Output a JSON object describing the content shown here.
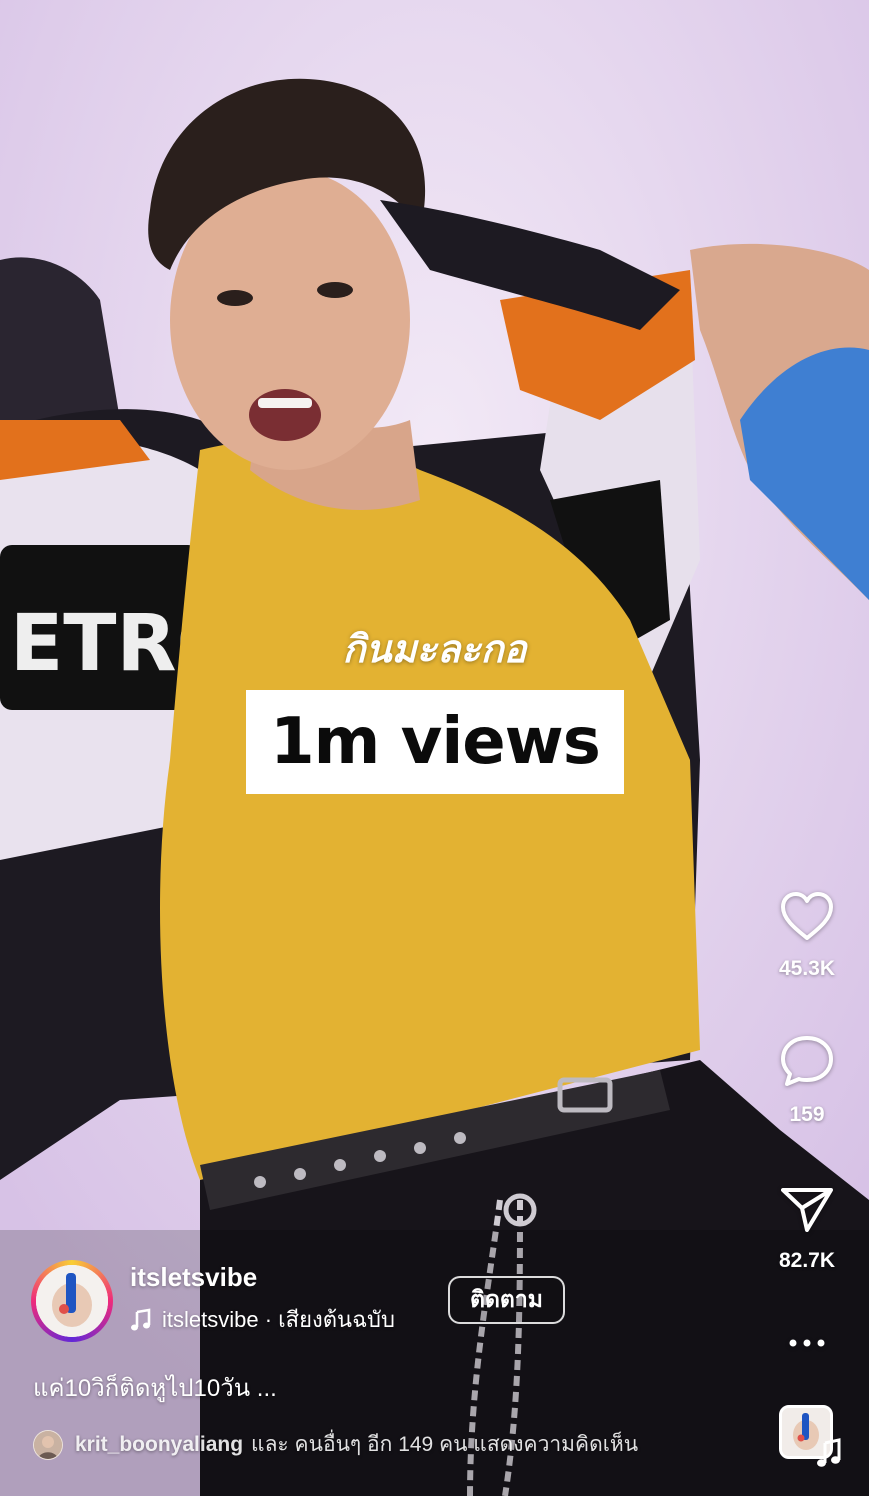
{
  "video": {
    "overlay_caption": "กินมะละกอ",
    "views_label": "1m views"
  },
  "actions": {
    "like_count": "45.3K",
    "comment_count": "159",
    "share_count": "82.7K",
    "like_icon": "heart-icon",
    "comment_icon": "comment-bubble-icon",
    "share_icon": "paper-plane-icon",
    "more_icon": "more-dots-icon"
  },
  "author": {
    "username": "itsletsvibe",
    "audio_owner": "itsletsvibe",
    "audio_separator": " · ",
    "audio_label": "เสียงต้นฉบับ",
    "follow_label": "ติดตาม"
  },
  "caption": "แค่10วิก็ติดหูไป10วัน ...",
  "comments": {
    "first_user": "krit_boonyaliang",
    "suffix": "และ คนอื่นๆ อีก 149 คน แสดงความคิดเห็น"
  },
  "colors": {
    "shirt": "#e3b232",
    "background": "#e4d3ee",
    "jacket_dark": "#1d1a22",
    "jacket_orange": "#e2711c"
  }
}
